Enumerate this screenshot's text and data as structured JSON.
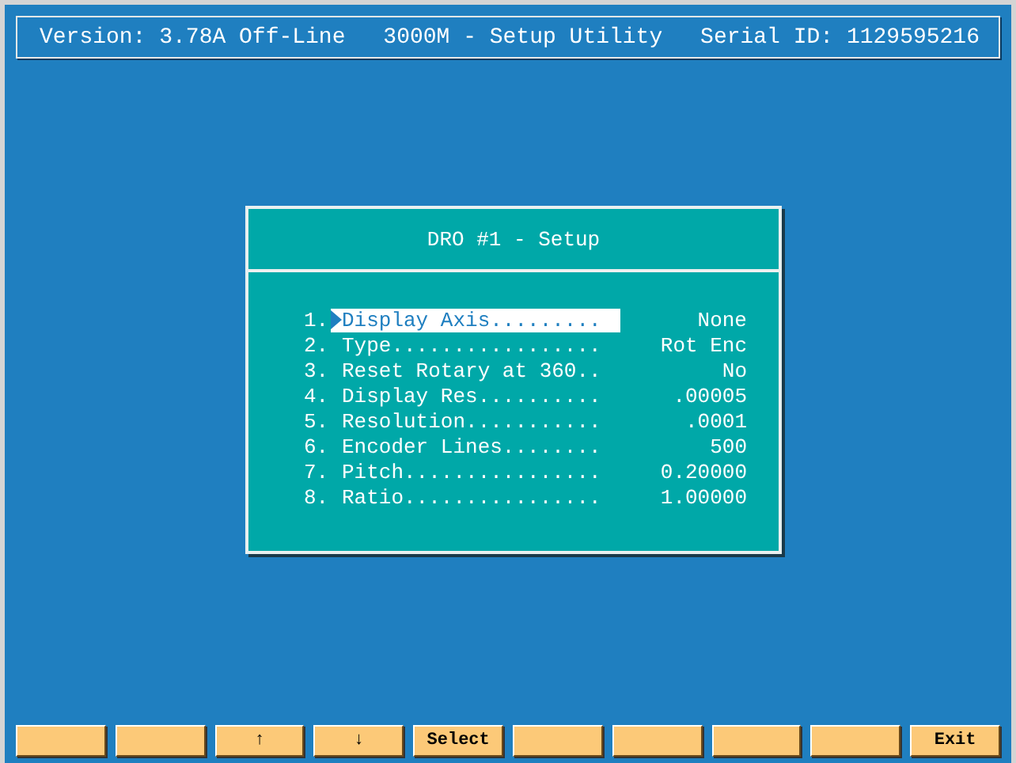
{
  "header": {
    "version": "Version: 3.78A Off-Line",
    "title": "3000M - Setup Utility",
    "serial": "Serial ID: 1129595216"
  },
  "dialog": {
    "title": "DRO #1 - Setup",
    "items": [
      {
        "number": "1.",
        "label": "Display Axis.........",
        "value": "None",
        "selected": true
      },
      {
        "number": "2.",
        "label": "Type.................",
        "value": "Rot Enc",
        "selected": false
      },
      {
        "number": "3.",
        "label": "Reset Rotary at 360..",
        "value": "No",
        "selected": false
      },
      {
        "number": "4.",
        "label": "Display Res..........",
        "value": ".00005",
        "selected": false
      },
      {
        "number": "5.",
        "label": "Resolution...........",
        "value": ".0001",
        "selected": false
      },
      {
        "number": "6.",
        "label": "Encoder Lines........",
        "value": "500",
        "selected": false
      },
      {
        "number": "7.",
        "label": "Pitch................",
        "value": "0.20000",
        "selected": false
      },
      {
        "number": "8.",
        "label": "Ratio................",
        "value": "1.00000",
        "selected": false
      }
    ]
  },
  "function_keys": [
    {
      "kind": "blank"
    },
    {
      "kind": "blank"
    },
    {
      "kind": "label",
      "label": "↑"
    },
    {
      "kind": "label",
      "label": "↓"
    },
    {
      "kind": "label",
      "label": "Select"
    },
    {
      "kind": "blank"
    },
    {
      "kind": "blank"
    },
    {
      "kind": "blank"
    },
    {
      "kind": "blank"
    },
    {
      "kind": "label",
      "label": "Exit"
    }
  ]
}
